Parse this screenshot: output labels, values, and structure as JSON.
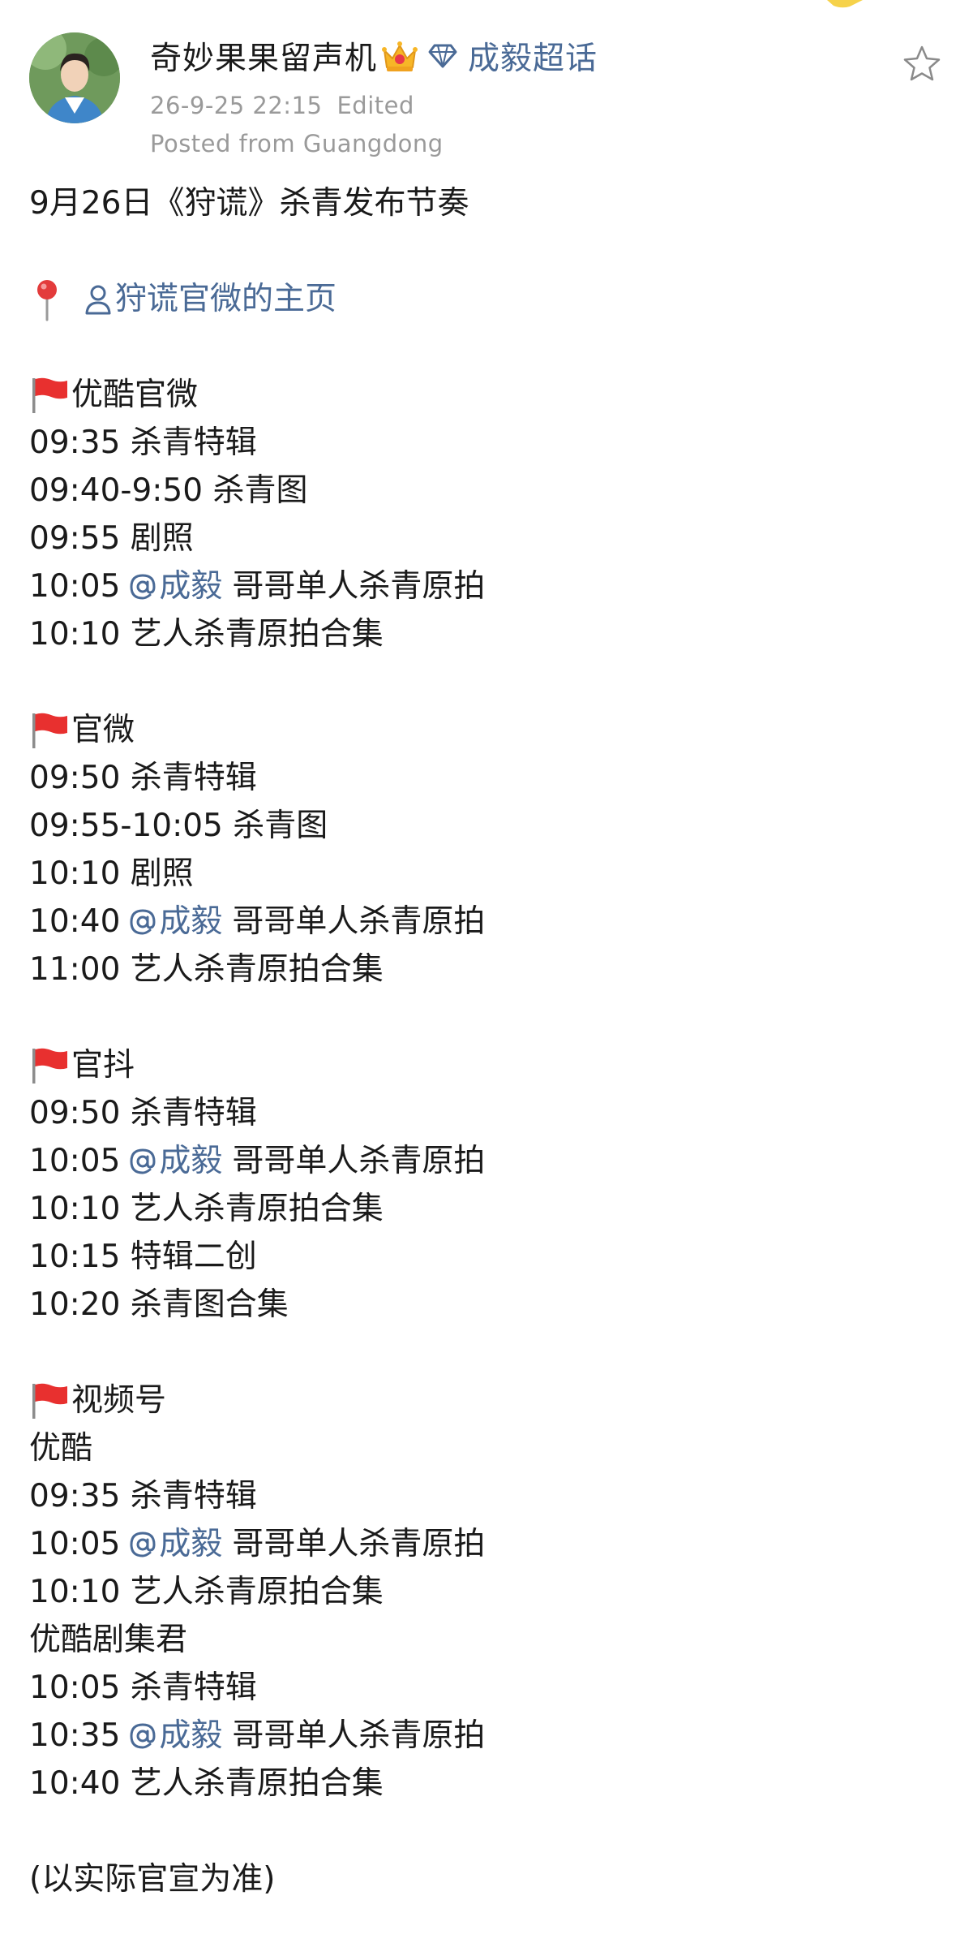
{
  "post": {
    "author": "奇妙果果留声机",
    "topic": "成毅超话",
    "timestamp": "26-9-25 22:15",
    "edited": "Edited",
    "location": "Posted from Guangdong",
    "icons": {
      "badge": "crown-icon",
      "topic": "diamond-icon",
      "favorite": "star-outline-icon"
    },
    "colors": {
      "link": "#4a6a96",
      "meta": "#9a9a9a",
      "text": "#1a1a1a"
    }
  },
  "body": {
    "intro": "9月26日《狩谎》杀青发布节奏",
    "location_link": "狩谎官微的主页",
    "sections": [
      {
        "title": "优酷官微",
        "lines": [
          {
            "text": "09:35 杀青特辑"
          },
          {
            "text": "09:40-9:50 杀青图"
          },
          {
            "text": "09:55 剧照"
          },
          {
            "time": "10:05",
            "mention": "成毅",
            "after": "哥哥单人杀青原拍"
          },
          {
            "text": "10:10 艺人杀青原拍合集"
          }
        ]
      },
      {
        "title": "官微",
        "lines": [
          {
            "text": "09:50 杀青特辑"
          },
          {
            "text": "09:55-10:05 杀青图"
          },
          {
            "text": "10:10 剧照"
          },
          {
            "time": "10:40",
            "mention": "成毅",
            "after": "哥哥单人杀青原拍"
          },
          {
            "text": "11:00 艺人杀青原拍合集"
          }
        ]
      },
      {
        "title": "官抖",
        "lines": [
          {
            "text": "09:50 杀青特辑"
          },
          {
            "time": "10:05",
            "mention": "成毅",
            "after": "哥哥单人杀青原拍"
          },
          {
            "text": "10:10 艺人杀青原拍合集"
          },
          {
            "text": "10:15 特辑二创"
          },
          {
            "text": "10:20 杀青图合集"
          }
        ]
      },
      {
        "title": "视频号",
        "lines": [
          {
            "text": "优酷"
          },
          {
            "text": "09:35 杀青特辑"
          },
          {
            "time": "10:05",
            "mention": "成毅",
            "after": "哥哥单人杀青原拍"
          },
          {
            "text": "10:10 艺人杀青原拍合集"
          },
          {
            "text": "优酷剧集君"
          },
          {
            "text": "10:05 杀青特辑"
          },
          {
            "time": "10:35",
            "mention": "成毅",
            "after": "哥哥单人杀青原拍"
          },
          {
            "text": "10:40 艺人杀青原拍合集"
          }
        ]
      }
    ],
    "footer": "(以实际官宣为准)"
  }
}
